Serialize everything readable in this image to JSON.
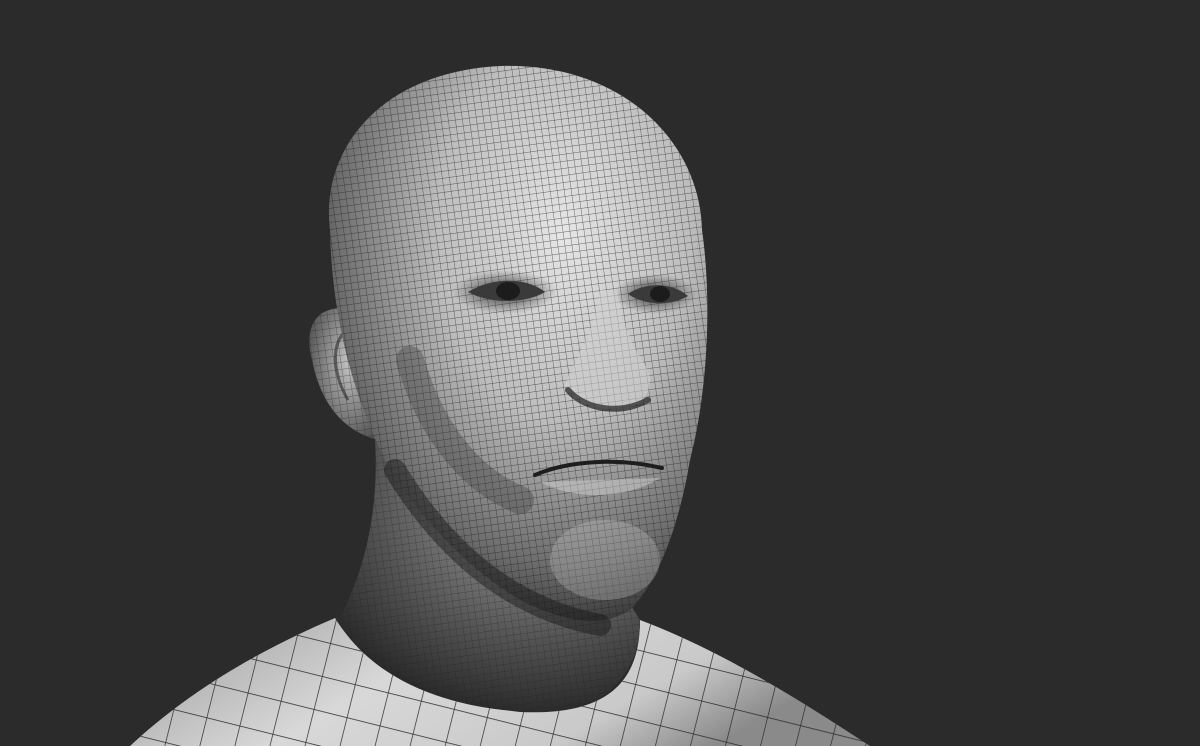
{
  "scene": {
    "background_color": "#2b2b2b",
    "subject": "sculpted-bust-wireframe",
    "mesh_color_light": "#d9d9d9",
    "mesh_color_dark": "#1a1a1a",
    "wire_color": "#202020"
  }
}
